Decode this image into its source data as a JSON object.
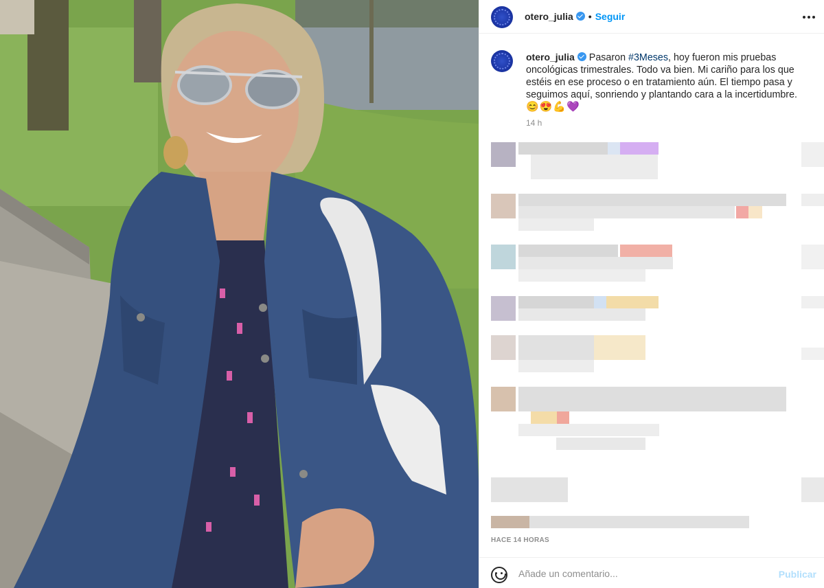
{
  "post": {
    "username": "otero_julia",
    "verified": true,
    "separator": "•",
    "follow_label": "Seguir",
    "more_icon": "ellipsis-horizontal-icon"
  },
  "caption": {
    "username": "otero_julia",
    "text_before": "Pasaron ",
    "hashtag": "#3Meses",
    "text_after": ", hoy fueron mis pruebas oncológicas trimestrales. Todo va bien. Mi cariño para los que estéis en ese proceso o en tratamiento aún. El tiempo pasa y seguimos aquí, sonriendo y plantando cara a la incertidumbre.",
    "emojis": "😊😍💪💜",
    "time": "14 h"
  },
  "timestamp": "HACE 14 HORAS",
  "footer": {
    "emoji_icon": "smiley-face-icon",
    "comment_placeholder": "Añade un comentario...",
    "publish_label": "Publicar"
  },
  "colors": {
    "link": "#0095f6",
    "publish_disabled": "#b2dffc",
    "hashtag": "#00376b",
    "avatar": "#1d37a8"
  }
}
